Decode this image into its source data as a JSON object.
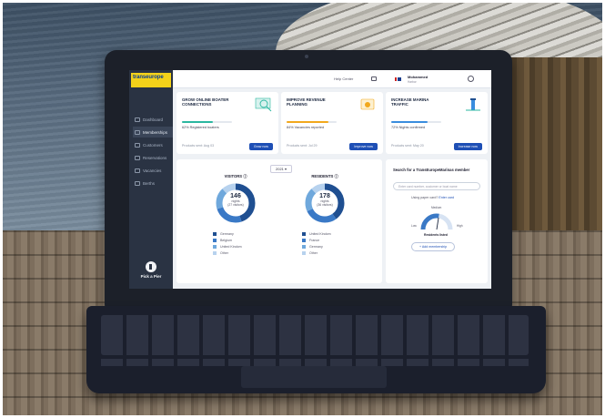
{
  "app": {
    "logo_text": "transeurope",
    "brand_name": "Pick a Pier"
  },
  "sidebar": {
    "items": [
      {
        "label": "Dashboard",
        "active": false
      },
      {
        "label": "Memberships",
        "active": true
      },
      {
        "label": "Customers",
        "active": false
      },
      {
        "label": "Reservations",
        "active": false
      },
      {
        "label": "Vacancies",
        "active": false
      },
      {
        "label": "Berths",
        "active": false
      }
    ]
  },
  "topbar": {
    "help": "Help Center",
    "user_name": "Mohammed",
    "user_sub": "Harbor"
  },
  "cards": [
    {
      "title": "GROW ONLINE BOATER CONNECTIONS",
      "stat": "62% Registered boaters",
      "progress": 0.62,
      "bar_color": "#2bb7a0",
      "foot": "Products sent: Aug 03",
      "button": "Grow now"
    },
    {
      "title": "IMPROVE REVENUE PLANNING",
      "stat": "84% Vacancies reported",
      "progress": 0.84,
      "bar_color": "#f2a81d",
      "foot": "Products sent: Jul 29",
      "button": "Improve now"
    },
    {
      "title": "INCREASE MARINA TRAFFIC",
      "stat": "72% Nights confirmed",
      "progress": 0.72,
      "bar_color": "#3a8dde",
      "foot": "Products sent: May 20",
      "button": "Increase now"
    }
  ],
  "stats": {
    "year": "2021",
    "visitors": {
      "title": "VISITORS",
      "total": "146",
      "unit": "nights",
      "sub": "(27 visitors)",
      "legend": [
        {
          "label": "Germany",
          "color": "#1f4f91",
          "value": 0.45
        },
        {
          "label": "Belgium",
          "color": "#3a79c6",
          "value": 0.25
        },
        {
          "label": "United Kindom",
          "color": "#6fa8dc",
          "value": 0.18
        },
        {
          "label": "Other",
          "color": "#b7d2ee",
          "value": 0.12
        }
      ]
    },
    "residents": {
      "title": "RESIDENTS",
      "total": "178",
      "unit": "nights",
      "sub": "(36 visitors)",
      "legend": [
        {
          "label": "United Kindom",
          "color": "#1f4f91",
          "value": 0.4
        },
        {
          "label": "France",
          "color": "#3a79c6",
          "value": 0.28
        },
        {
          "label": "Germany",
          "color": "#6fa8dc",
          "value": 0.2
        },
        {
          "label": "Other",
          "color": "#b7d2ee",
          "value": 0.12
        }
      ]
    }
  },
  "search": {
    "title": "Search for a TransEuropeMarinas member",
    "placeholder": "Enter card number, customer or boat name",
    "paper_question": "Using paper card?",
    "paper_link": "Enter card",
    "gauge_low": "Low",
    "gauge_medium": "Medium",
    "gauge_high": "High",
    "gauge_caption": "Residents listed",
    "gauge_level": 0.55,
    "add_button": "+ Add membership"
  }
}
